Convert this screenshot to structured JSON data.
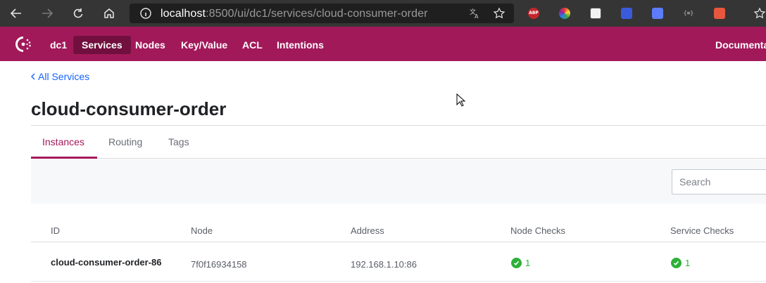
{
  "browser": {
    "url_host": "localhost",
    "url_rest": ":8500/ui/dc1/services/cloud-consumer-order",
    "extensions": [
      "adblock-plus-icon",
      "color-wheel-icon",
      "glasses-icon",
      "reader-icon",
      "bookmark-icon",
      "code-icon",
      "puzzle-icon"
    ]
  },
  "header": {
    "datacenter": "dc1",
    "nav": [
      "Services",
      "Nodes",
      "Key/Value",
      "ACL",
      "Intentions"
    ],
    "active_nav": "Services",
    "documentation": "Documenta",
    "accent_color": "#a2195a"
  },
  "page": {
    "back_link": "All Services",
    "title": "cloud-consumer-order",
    "tabs": [
      "Instances",
      "Routing",
      "Tags"
    ],
    "active_tab": "Instances",
    "search_placeholder": "Search"
  },
  "table": {
    "columns": [
      "ID",
      "Node",
      "Address",
      "Node Checks",
      "Service Checks"
    ],
    "rows": [
      {
        "id": "cloud-consumer-order-86",
        "node": "7f0f16934158",
        "address": "192.168.1.10:86",
        "node_checks": "1",
        "service_checks": "1"
      }
    ],
    "passing_color": "#2eb039"
  }
}
